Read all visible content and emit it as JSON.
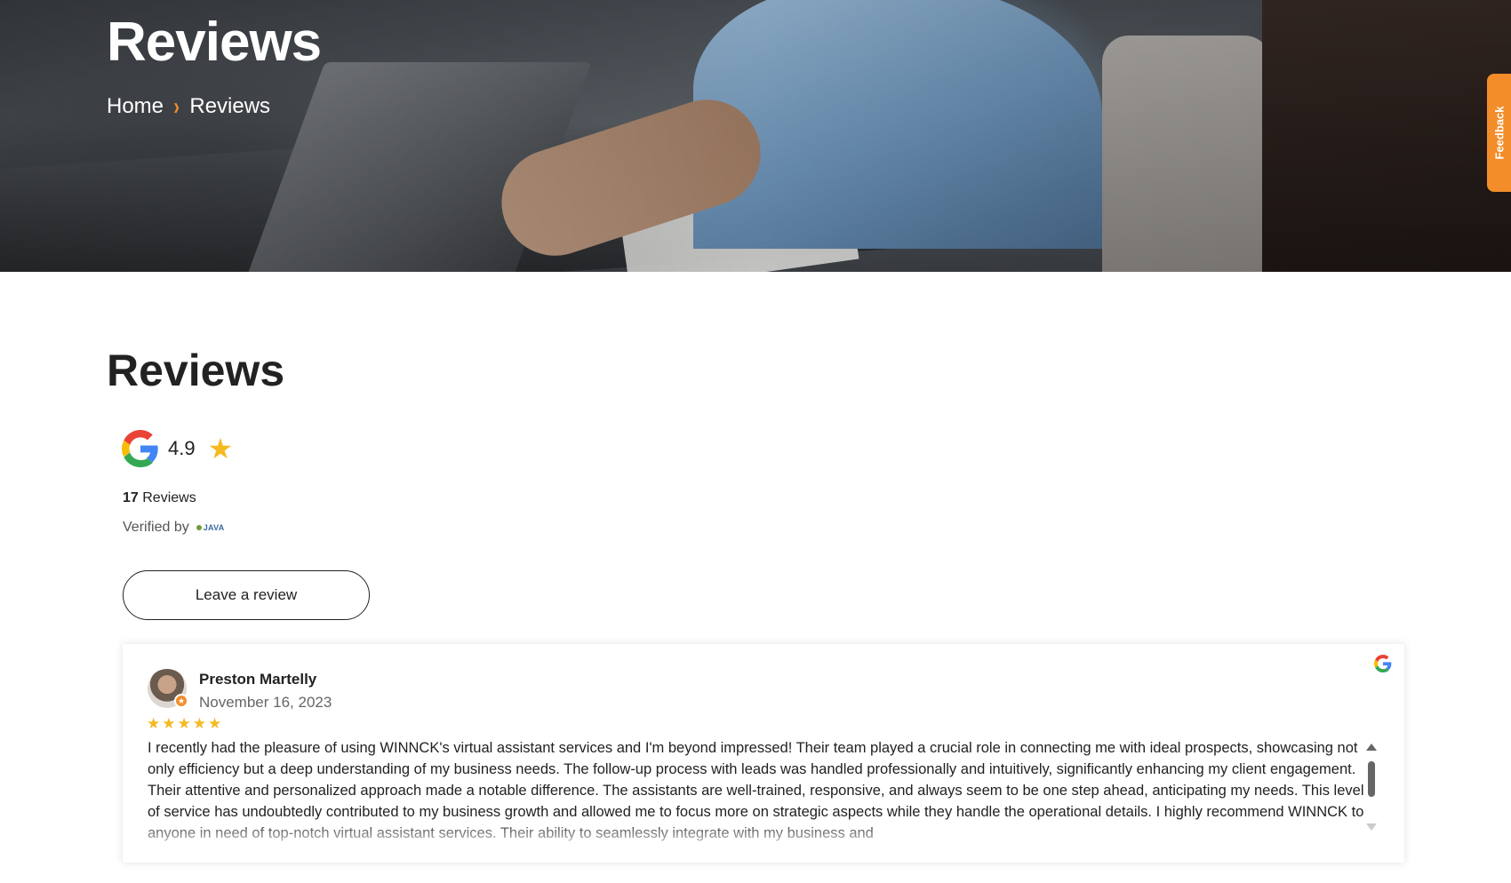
{
  "hero": {
    "title": "Reviews",
    "breadcrumb": {
      "home": "Home",
      "separator": "›",
      "current": "Reviews"
    }
  },
  "feedback_tab": {
    "label": "Feedback",
    "color": "#f28d2a"
  },
  "section": {
    "title": "Reviews"
  },
  "rating": {
    "value": "4.9",
    "star_icon": "star-icon",
    "count": "17",
    "count_label": "Reviews",
    "verified_label": "Verified by",
    "verified_logo": "JAVA"
  },
  "actions": {
    "leave_review": "Leave a review"
  },
  "reviews": [
    {
      "name": "Preston Martelly",
      "date": "November 16, 2023",
      "stars": "★★★★★",
      "rating": 5,
      "text": "I recently had the pleasure of using WINNCK's virtual assistant services and I'm beyond impressed! Their team played a crucial role in connecting me with ideal prospects, showcasing not only efficiency but a deep understanding of my business needs. The follow-up process with leads was handled professionally and intuitively, significantly enhancing my client engagement. Their attentive and personalized approach made a notable difference. The assistants are well-trained, responsive, and always seem to be one step ahead, anticipating my needs. This level of service has undoubtedly contributed to my business growth and allowed me to focus more on strategic aspects while they handle the operational details. I highly recommend WINNCK to anyone in need of top-notch virtual assistant services. Their ability to seamlessly integrate with my business and"
    }
  ],
  "colors": {
    "accent": "#f28d2a",
    "star": "#f5b921"
  }
}
